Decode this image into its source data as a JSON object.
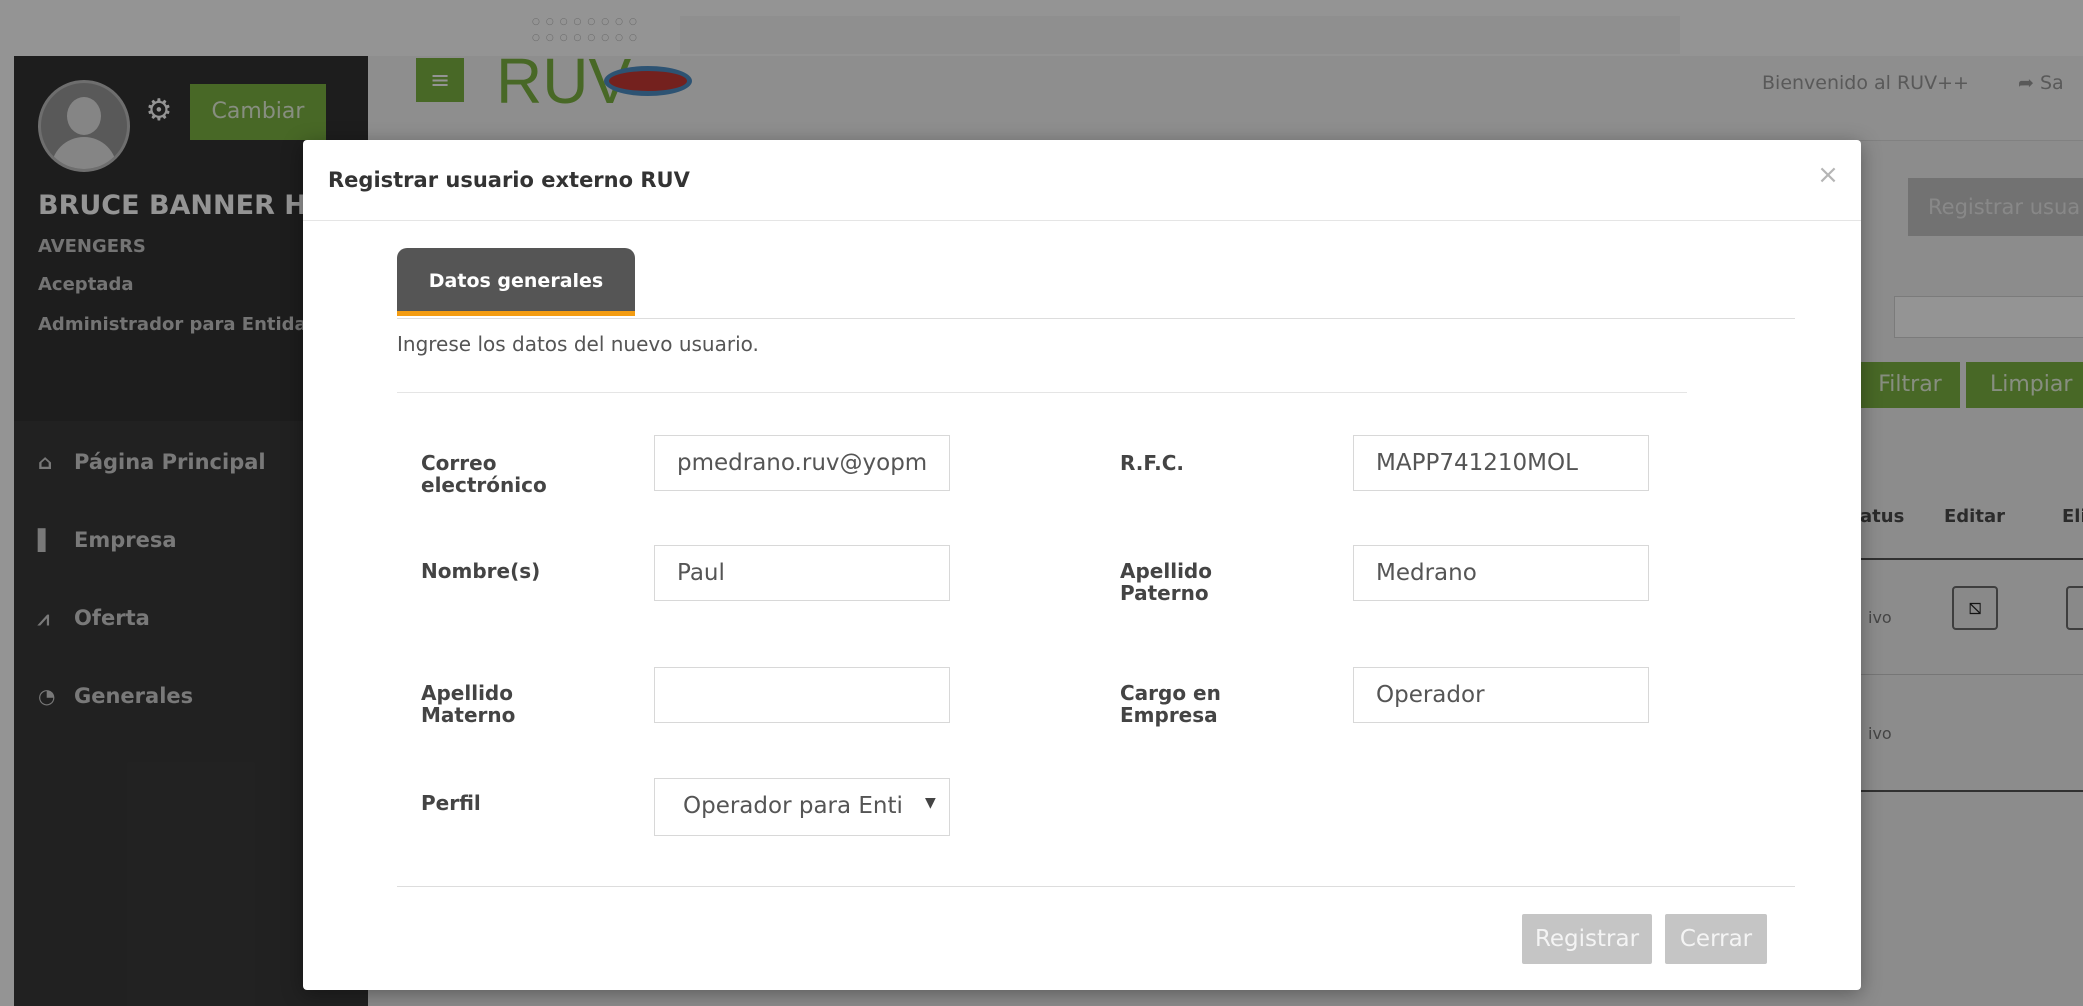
{
  "app": {
    "brand": "RUV",
    "brand_mark": "++",
    "welcome": "Bienvenido al RUV++",
    "logout_label": "Sa"
  },
  "sidebar": {
    "change_button": "Cambiar",
    "user_name": "BRUCE BANNER HULK",
    "organization": "AVENGERS",
    "status": "Aceptada",
    "role": "Administrador para Entidad Ejecutora",
    "items": [
      {
        "label": "Página Principal",
        "icon": "home-icon",
        "glyph": "⌂"
      },
      {
        "label": "Empresa",
        "icon": "building-icon",
        "glyph": "▌"
      },
      {
        "label": "Oferta",
        "icon": "chart-icon",
        "glyph": "⩘"
      },
      {
        "label": "Generales",
        "icon": "dashboard-icon",
        "glyph": "◔"
      }
    ]
  },
  "background_page": {
    "register_button": "Registrar usua",
    "filter_button": "Filtrar",
    "clear_button": "Limpiar",
    "columns": [
      "atus",
      "Editar",
      "Elim"
    ],
    "rows": [
      {
        "status": "ivo"
      },
      {
        "status": "ivo"
      }
    ]
  },
  "modal": {
    "title": "Registrar usuario externo RUV",
    "close": "×",
    "tab_label": "Datos generales",
    "intro": "Ingrese los datos del nuevo usuario.",
    "fields": {
      "email": {
        "label": "Correo electrónico",
        "value": "pmedrano.ruv@yopmail.com"
      },
      "rfc": {
        "label": "R.F.C.",
        "value": "MAPP741210MOL"
      },
      "first_name": {
        "label": "Nombre(s)",
        "value": "Paul"
      },
      "last_name_paternal": {
        "label": "Apellido Paterno",
        "value": "Medrano"
      },
      "last_name_maternal": {
        "label": "Apellido Materno",
        "value": ""
      },
      "position": {
        "label": "Cargo en Empresa",
        "value": "Operador"
      },
      "profile": {
        "label": "Perfil",
        "value": "Operador para Entidad Ejecutora"
      }
    },
    "register_button": "Registrar",
    "close_button": "Cerrar"
  }
}
